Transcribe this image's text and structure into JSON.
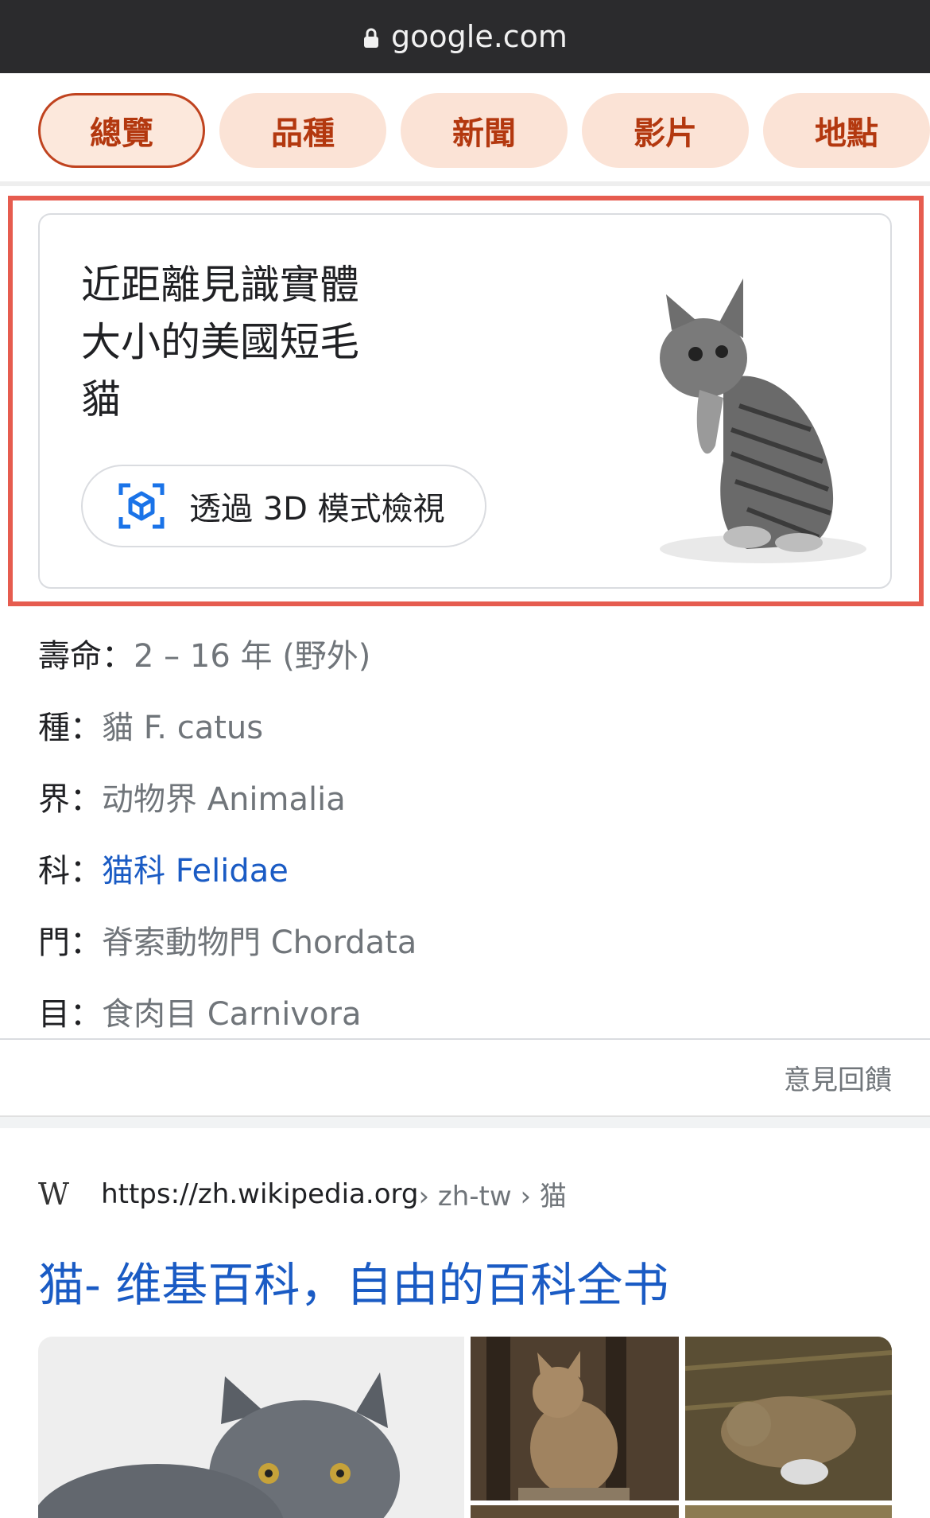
{
  "browser": {
    "url": "google.com"
  },
  "tabs": [
    "總覽",
    "品種",
    "新聞",
    "影片",
    "地點"
  ],
  "card3d": {
    "title_line1": "近距離見識實體",
    "title_line2": "大小的美國短毛",
    "title_line3": "貓",
    "button_label": "透過 3D 模式檢視"
  },
  "facts": [
    {
      "label": "壽命：",
      "value": "2 – 16 年 (野外)"
    },
    {
      "label": "種：",
      "value": "貓 F. catus"
    },
    {
      "label": "界：",
      "value": "动物界 Animalia"
    },
    {
      "label": "科：",
      "value": "猫科 Felidae"
    },
    {
      "label": "門：",
      "value": "脊索動物門 Chordata"
    },
    {
      "label": "目：",
      "value": "食肉目 Carnivora"
    }
  ],
  "feedback": "意見回饋",
  "result": {
    "site_logo": "W",
    "url": "https://zh.wikipedia.org",
    "breadcrumb": " › zh-tw › 猫",
    "title": "猫- 维基百科，自由的百科全书"
  },
  "colors": {
    "accent": "#b3380f",
    "tab_bg": "#fbe3d6",
    "link": "#1a5bc4",
    "highlight": "#e65c4f"
  }
}
